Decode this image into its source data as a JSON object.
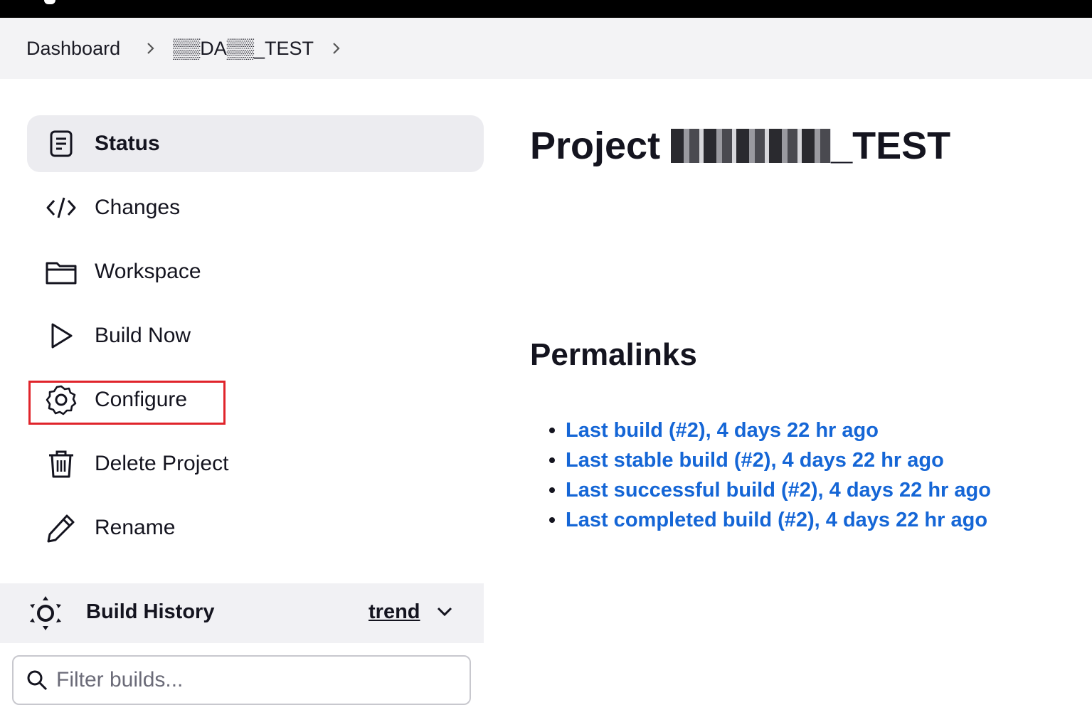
{
  "breadcrumb": {
    "items": [
      "Dashboard",
      "▒▒DA▒▒_TEST"
    ]
  },
  "sidebar": {
    "tasks": [
      {
        "label": "Status",
        "icon": "document-icon"
      },
      {
        "label": "Changes",
        "icon": "code-icon"
      },
      {
        "label": "Workspace",
        "icon": "folder-icon"
      },
      {
        "label": "Build Now",
        "icon": "play-icon"
      },
      {
        "label": "Configure",
        "icon": "gear-icon"
      },
      {
        "label": "Delete Project",
        "icon": "trash-icon"
      },
      {
        "label": "Rename",
        "icon": "pencil-icon"
      }
    ],
    "active_task": "Status",
    "highlighted_task": "Configure",
    "highlight_color": "#e0242b"
  },
  "build_history": {
    "title": "Build History",
    "trend_label": "trend",
    "filter_placeholder": "Filter builds..."
  },
  "main": {
    "title_prefix": "Project",
    "title_suffix": "_TEST",
    "permalinks_heading": "Permalinks",
    "permalinks": [
      "Last build (#2), 4 days 22 hr ago",
      "Last stable build (#2), 4 days 22 hr ago",
      "Last successful build (#2), 4 days 22 hr ago",
      "Last completed build (#2), 4 days 22 hr ago"
    ]
  },
  "colors": {
    "link": "#1566d6",
    "topbar": "#000000",
    "breadcrumb_bg": "#f3f3f5",
    "active_task_bg": "#ececf0"
  }
}
